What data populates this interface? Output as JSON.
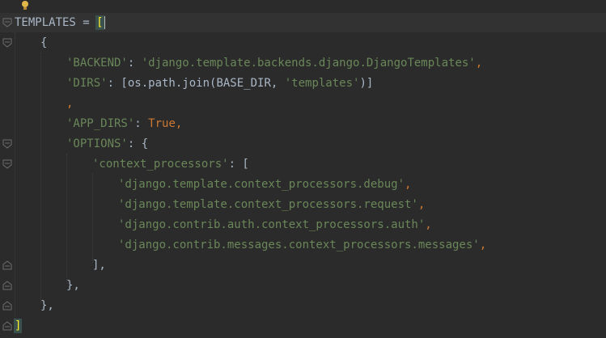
{
  "editor": {
    "colors": {
      "background": "#2b2b2b",
      "current_line": "#323232",
      "default_text": "#a9b7c6",
      "string": "#6a8759",
      "keyword": "#cc7832",
      "bracket_match": "#ffef28"
    },
    "lines": [
      {
        "parts": [
          "TEMPLATES = ",
          "["
        ]
      },
      {
        "parts": [
          "{"
        ]
      },
      {
        "parts": [
          "'BACKEND'",
          ": ",
          "'django.template.backends.django.DjangoTemplates'",
          ","
        ]
      },
      {
        "parts": [
          "'DIRS'",
          ": [os.path.join(BASE_DIR, ",
          "'templates'",
          ")]"
        ]
      },
      {
        "parts": [
          ","
        ]
      },
      {
        "parts": [
          "'APP_DIRS'",
          ": ",
          "True",
          ","
        ]
      },
      {
        "parts": [
          "'OPTIONS'",
          ": {"
        ]
      },
      {
        "parts": [
          "'context_processors'",
          ": ["
        ]
      },
      {
        "parts": [
          "'django.template.context_processors.debug'",
          ","
        ]
      },
      {
        "parts": [
          "'django.template.context_processors.request'",
          ","
        ]
      },
      {
        "parts": [
          "'django.contrib.auth.context_processors.auth'",
          ","
        ]
      },
      {
        "parts": [
          "'django.contrib.messages.context_processors.messages'",
          ","
        ]
      },
      {
        "parts": [
          "],"
        ]
      },
      {
        "parts": [
          "},"
        ]
      },
      {
        "parts": [
          "},"
        ]
      },
      {
        "parts": [
          "]"
        ]
      }
    ],
    "icons": {
      "intention": "lightbulb-icon",
      "fold": "fold-marker-icon"
    }
  }
}
